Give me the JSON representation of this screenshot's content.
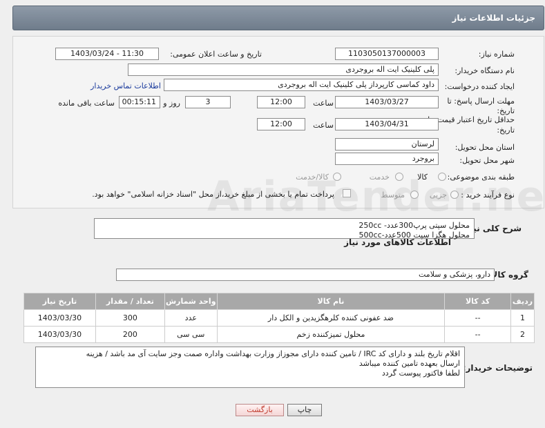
{
  "header": {
    "title": "جزئیات اطلاعات نیاز"
  },
  "fields": {
    "need_number_label": "شماره نیاز:",
    "need_number": "1103050137000003",
    "announce_label": "تاریخ و ساعت اعلان عمومی:",
    "announce_value": "1403/03/24 - 11:30",
    "buyer_org_label": "نام دستگاه خریدار:",
    "buyer_org": "پلی کلینیک ایت اله بروجردی",
    "creator_label": "ایجاد کننده درخواست:",
    "creator": "داود کماسی کارپرداز پلی کلینیک ایت اله بروجردی",
    "contact_link": "اطلاعات تماس خریدار",
    "reply_deadline_label1": "مهلت ارسال پاسخ: تا",
    "reply_deadline_label2": "تاریخ:",
    "reply_date": "1403/03/27",
    "time_label": "ساعت",
    "reply_time": "12:00",
    "days_value": "3",
    "days_label": "روز و",
    "remaining_time": "00:15:11",
    "remaining_label": "ساعت باقی مانده",
    "price_deadline_label1": "حداقل تاریخ اعتبار قیمت: تا",
    "price_deadline_label2": "تاریخ:",
    "price_date": "1403/04/31",
    "price_time": "12:00",
    "province_label": "استان محل تحویل:",
    "province": "لرستان",
    "city_label": "شهر محل تحویل:",
    "city": "بروجرد",
    "category_label": "طبقه بندی موضوعی:",
    "category_options": [
      "کالا",
      "خدمت",
      "کالا/خدمت"
    ],
    "process_label": "نوع فرآیند خرید :",
    "process_options": [
      "جزیی",
      "متوسط"
    ],
    "payment_note": "پرداخت تمام یا بخشی از مبلغ خرید،از محل \"اسناد خزانه اسلامی\" خواهد بود."
  },
  "summary": {
    "label": "شرح کلی نیاز:",
    "lines": [
      "محلول سپتی پرپ300عدد- 250cc",
      "محلول هگزا سپت 500عدد-500cc"
    ]
  },
  "goods_section": {
    "title": "اطلاعات کالاهای مورد نیاز"
  },
  "group": {
    "label": "گروه کالا:",
    "value": "دارو، پزشکی و سلامت"
  },
  "table": {
    "headers": [
      "ردیف",
      "کد کالا",
      "نام کالا",
      "واحد شمارش",
      "تعداد / مقدار",
      "تاریخ نیاز"
    ],
    "rows": [
      [
        "1",
        "--",
        "ضد عفونی کننده کلرهگزیدین و الکل دار",
        "عدد",
        "300",
        "1403/03/30"
      ],
      [
        "2",
        "--",
        "محلول تمیزکننده زخم",
        "سی سی",
        "200",
        "1403/03/30"
      ]
    ]
  },
  "notes": {
    "label": "توضیحات خریدار:",
    "lines": [
      "اقلام تاریخ بلند و دارای کد IRC  / تامین کننده دارای مجوزاز وزارت بهداشت واداره صمت وجز سایت آی مد باشد /  هزینه",
      "ارسال بعهده تامین کننده میباشد",
      "لطفا فاکتور پیوست گردد"
    ]
  },
  "buttons": {
    "print": "چاپ",
    "back": "بازگشت"
  },
  "watermark": "AriaTender.neT",
  "colors": {
    "header": "#7d8896",
    "table_header": "#a8a8a8",
    "link": "#1a3a9c",
    "back_button_text": "#c0392b"
  }
}
